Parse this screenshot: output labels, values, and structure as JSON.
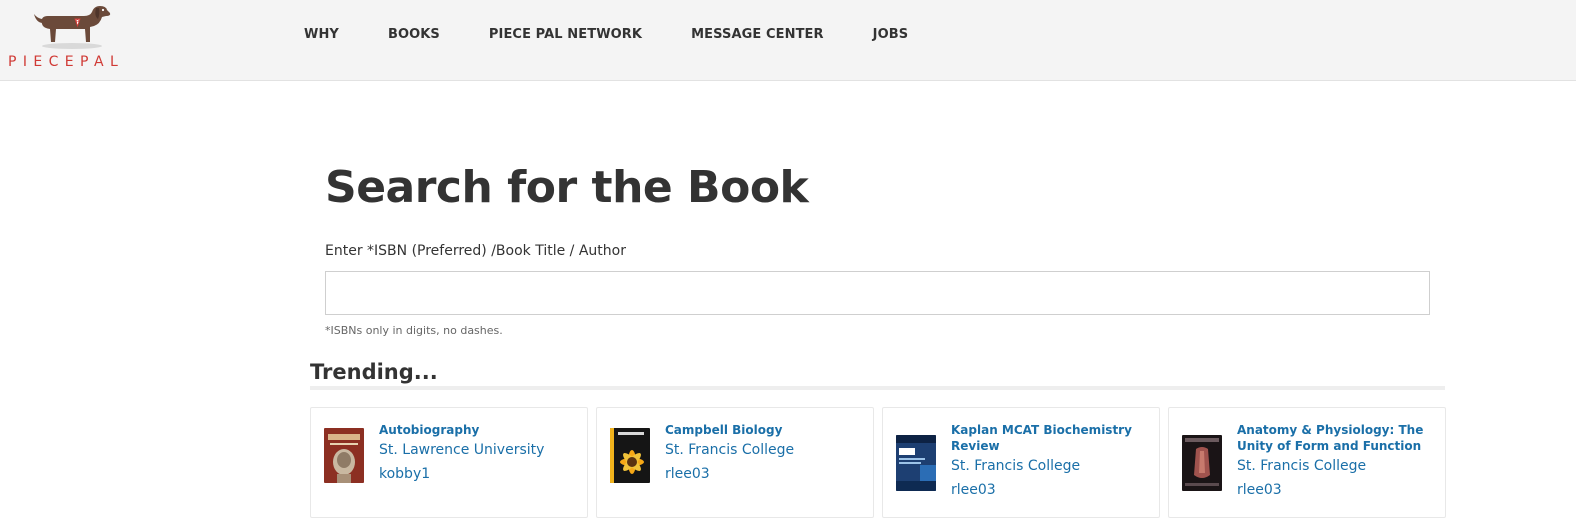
{
  "brand": {
    "name": "PIECEPAL"
  },
  "nav": {
    "items": [
      {
        "label": "WHY"
      },
      {
        "label": "BOOKS"
      },
      {
        "label": "PIECE PAL NETWORK"
      },
      {
        "label": "MESSAGE CENTER"
      },
      {
        "label": "JOBS"
      }
    ]
  },
  "search": {
    "title": "Search for the Book",
    "label": "Enter *ISBN (Preferred) /Book Title / Author",
    "value": "",
    "placeholder": "",
    "hint": "*ISBNs only in digits, no dashes."
  },
  "trending": {
    "title": "Trending...",
    "books": [
      {
        "title": "Autobiography",
        "school": "St. Lawrence University",
        "user": "kobby1"
      },
      {
        "title": "Campbell Biology",
        "school": "St. Francis College",
        "user": "rlee03"
      },
      {
        "title": "Kaplan MCAT Biochemistry Review",
        "school": "St. Francis College",
        "user": "rlee03"
      },
      {
        "title": "Anatomy & Physiology: The Unity of Form and Function",
        "school": "St. Francis College",
        "user": "rlee03"
      }
    ]
  },
  "colors": {
    "accent": "#d03a35",
    "link": "#1a6fa8",
    "text": "#333333",
    "header_bg": "#f4f4f4"
  },
  "icons": {
    "logo": "dachshund-logo-icon"
  }
}
